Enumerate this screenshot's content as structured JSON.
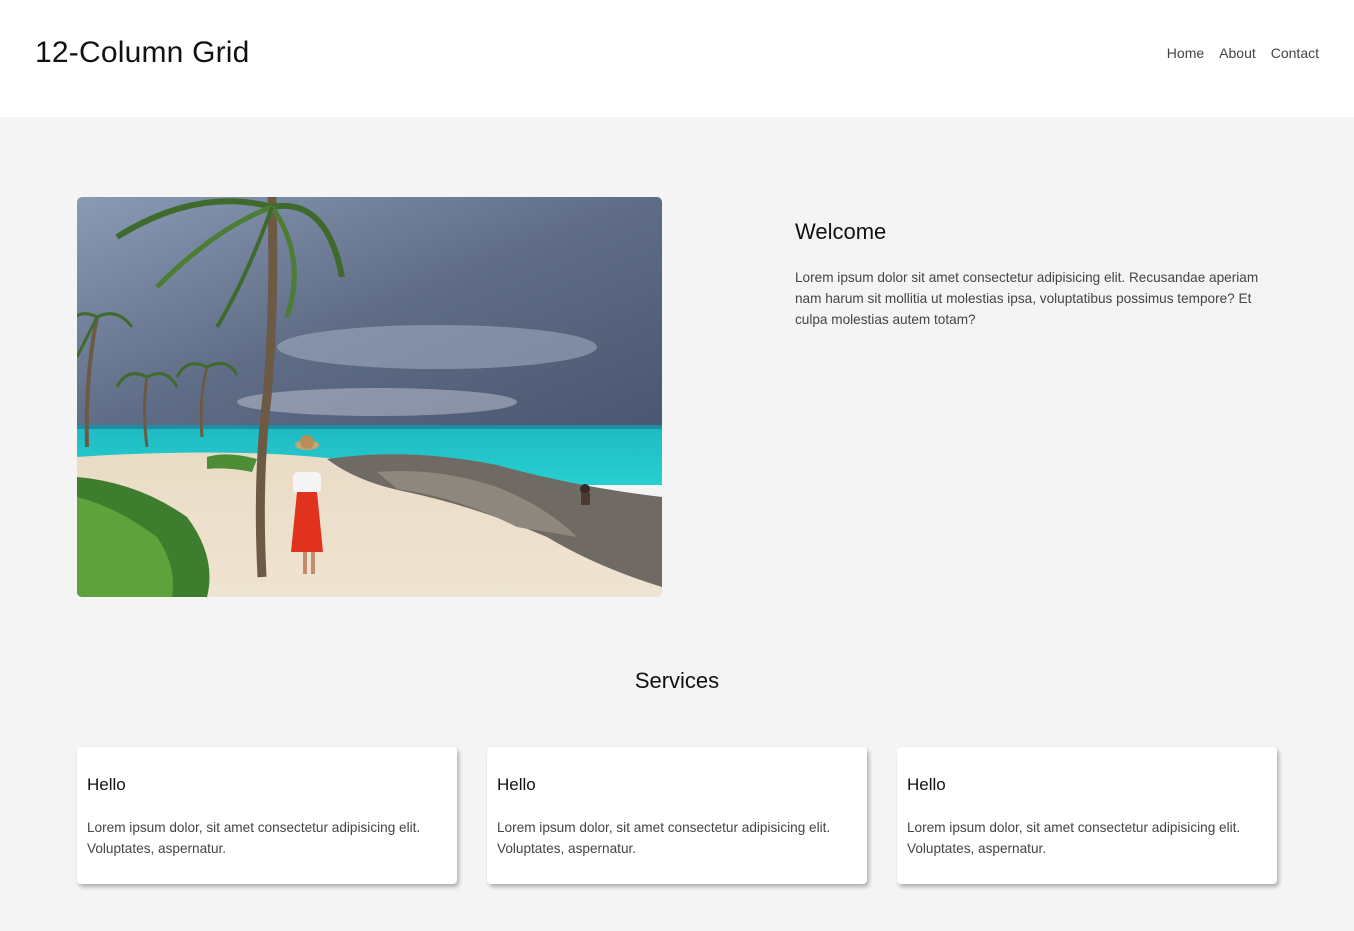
{
  "header": {
    "logo": "12-Column Grid",
    "nav": [
      "Home",
      "About",
      "Contact"
    ]
  },
  "hero": {
    "image_name": "beach-palm-photo"
  },
  "welcome": {
    "title": "Welcome",
    "text": "Lorem ipsum dolor sit amet consectetur adipisicing elit. Recusandae aperiam nam harum sit mollitia ut molestias ipsa, voluptatibus possimus tempore? Et culpa molestias autem totam?"
  },
  "services": {
    "title": "Services",
    "cards": [
      {
        "title": "Hello",
        "text": "Lorem ipsum dolor, sit amet consectetur adipisicing elit. Voluptates, aspernatur."
      },
      {
        "title": "Hello",
        "text": "Lorem ipsum dolor, sit amet consectetur adipisicing elit. Voluptates, aspernatur."
      },
      {
        "title": "Hello",
        "text": "Lorem ipsum dolor, sit amet consectetur adipisicing elit. Voluptates, aspernatur."
      }
    ]
  },
  "colors": {
    "header_bg": "#ffffff",
    "page_bg": "#f4f4f4",
    "text": "#111111",
    "muted_text": "#444444"
  }
}
